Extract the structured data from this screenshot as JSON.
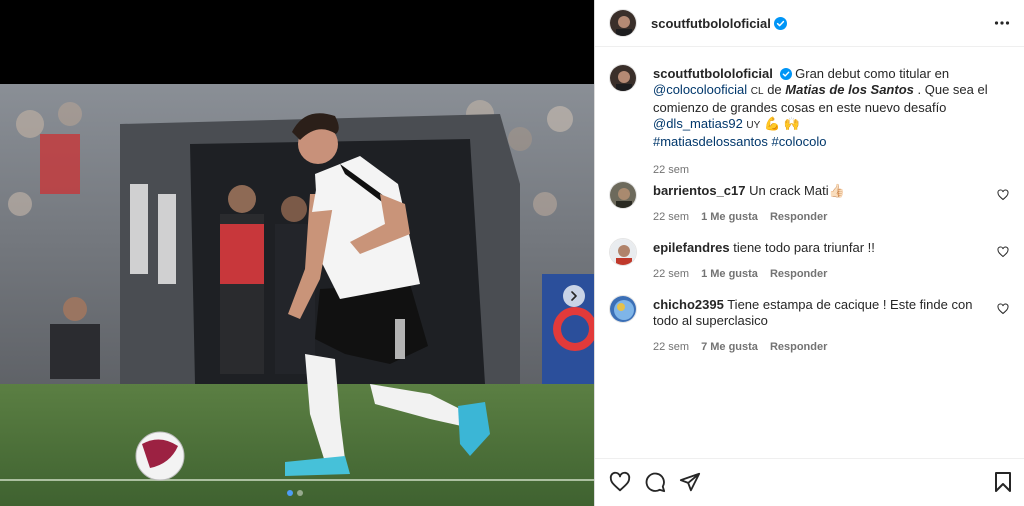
{
  "post": {
    "account": "scoutfutbololoficial"
  },
  "header": {
    "username": "scoutfutbololoficial",
    "more_icon": "more-horizontal-icon"
  },
  "caption": {
    "username": "scoutfutbololoficial",
    "text_1": "Gran debut como titular en",
    "mention_club": "@colocolooficial",
    "flag": "CL",
    "text_2": "de",
    "player_name": "Matias de los Santos",
    "text_3": ". Que sea el comienzo de grandes cosas en este nuevo desafío",
    "mention_player": "@dls_matias92",
    "flag2": "UY",
    "emojis": "💪 🙌",
    "hashtag_1": "#matiasdelossantos",
    "hashtag_2": "#colocolo",
    "time": "22 sem"
  },
  "comments": [
    {
      "username": "barrientos_c17",
      "text": "Un crack Mati👍🏻",
      "time": "22 sem",
      "likes": "1 Me gusta",
      "reply": "Responder"
    },
    {
      "username": "epilefandres",
      "text": "tiene todo para triunfar !!",
      "time": "22 sem",
      "likes": "1 Me gusta",
      "reply": "Responder"
    },
    {
      "username": "chicho2395",
      "text": "Tiene estampa de cacique ! Este finde con todo al superclasico",
      "time": "22 sem",
      "likes": "7 Me gusta",
      "reply": "Responder"
    }
  ],
  "carousel": {
    "current": 1,
    "total": 2
  },
  "colors": {
    "link": "#00376b",
    "verified": "#0095f6",
    "active_dot": "#4d9df7"
  }
}
